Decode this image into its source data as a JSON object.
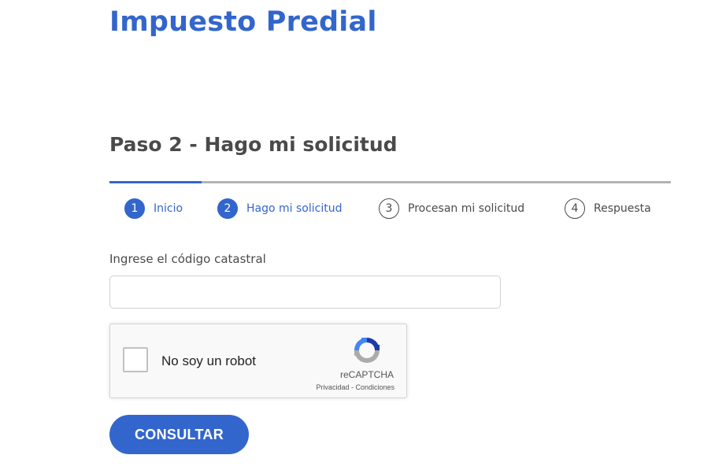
{
  "page": {
    "title": "Impuesto Predial",
    "step_heading": "Paso 2 - Hago mi solicitud"
  },
  "progress": {
    "completed_fraction": 0.164
  },
  "steps": [
    {
      "number": "1",
      "label": "Inicio",
      "state": "active"
    },
    {
      "number": "2",
      "label": "Hago mi solicitud",
      "state": "active"
    },
    {
      "number": "3",
      "label": "Procesan mi solicitud",
      "state": "inactive"
    },
    {
      "number": "4",
      "label": "Respuesta",
      "state": "inactive"
    }
  ],
  "form": {
    "cadastral_label": "Ingrese el código catastral",
    "cadastral_value": "",
    "cadastral_placeholder": ""
  },
  "recaptcha": {
    "label": "No soy un robot",
    "brand": "reCAPTCHA",
    "privacy_link": "Privacidad",
    "separator": " - ",
    "terms_link": "Condiciones",
    "checked": false
  },
  "actions": {
    "submit_label": "CONSULTAR"
  },
  "colors": {
    "accent": "#3366cc",
    "text": "#4a4a4a",
    "track": "#b3b3b3"
  }
}
